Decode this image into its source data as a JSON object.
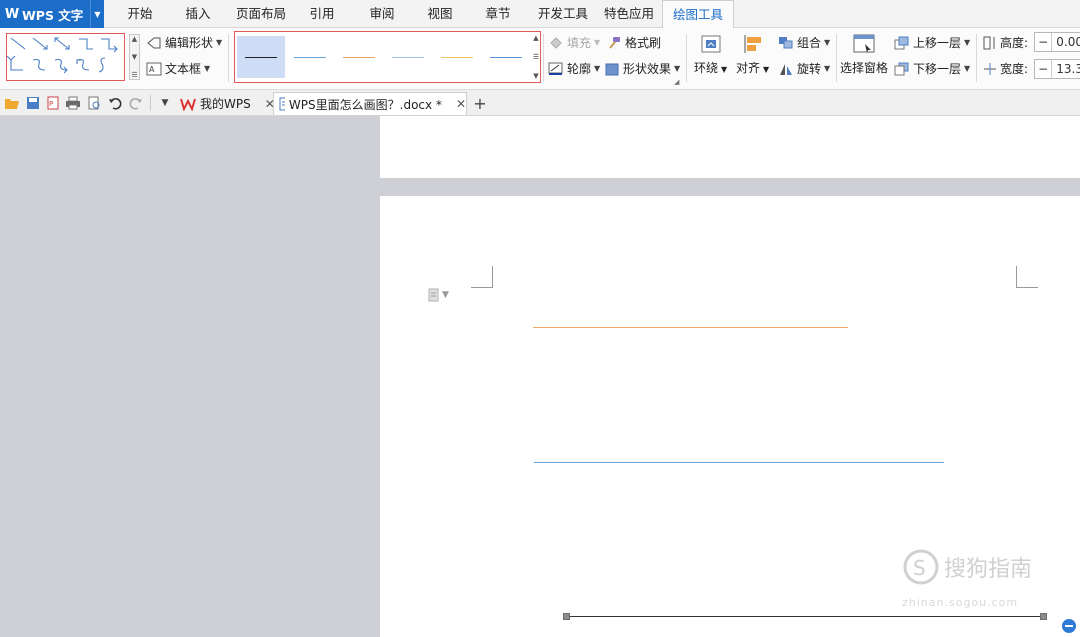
{
  "app": {
    "title": "WPS 文字",
    "logo_glyph": "W",
    "accent_color": "#1c6dc8"
  },
  "menu": {
    "tabs": [
      "开始",
      "插入",
      "页面布局",
      "引用",
      "审阅",
      "视图",
      "章节",
      "开发工具",
      "特色应用",
      "绘图工具"
    ],
    "active_tab": "绘图工具"
  },
  "ribbon": {
    "edit_shape": "编辑形状",
    "text_box": "文本框",
    "fill": "填充",
    "format_painter": "格式刷",
    "outline": "轮廓",
    "shape_effects": "形状效果",
    "wrap": "环绕",
    "align": "对齐",
    "group": "组合",
    "rotate": "旋转",
    "selection_pane": "选择窗格",
    "bring_forward": "上移一层",
    "send_backward": "下移一层",
    "height_label": "高度:",
    "height_value": "0.00",
    "width_label": "宽度:",
    "width_value": "13.3",
    "line_styles": [
      {
        "color": "#222222"
      },
      {
        "color": "#6aa6dc"
      },
      {
        "color": "#e8a36a"
      },
      {
        "color": "#9fc2e6"
      },
      {
        "color": "#f2c26a"
      },
      {
        "color": "#5b92d6"
      }
    ],
    "highlight_color": "#e05a5a"
  },
  "doc_tabs": {
    "tab1": "我的WPS",
    "tab2": "WPS里面怎么画图？.docx *"
  },
  "document": {
    "lines": [
      {
        "color": "#f0a868"
      },
      {
        "color": "#6aa6dc"
      },
      {
        "color": "#333333"
      }
    ]
  },
  "watermark": {
    "text": "搜狗指南",
    "url": "zhinan.sogou.com"
  }
}
